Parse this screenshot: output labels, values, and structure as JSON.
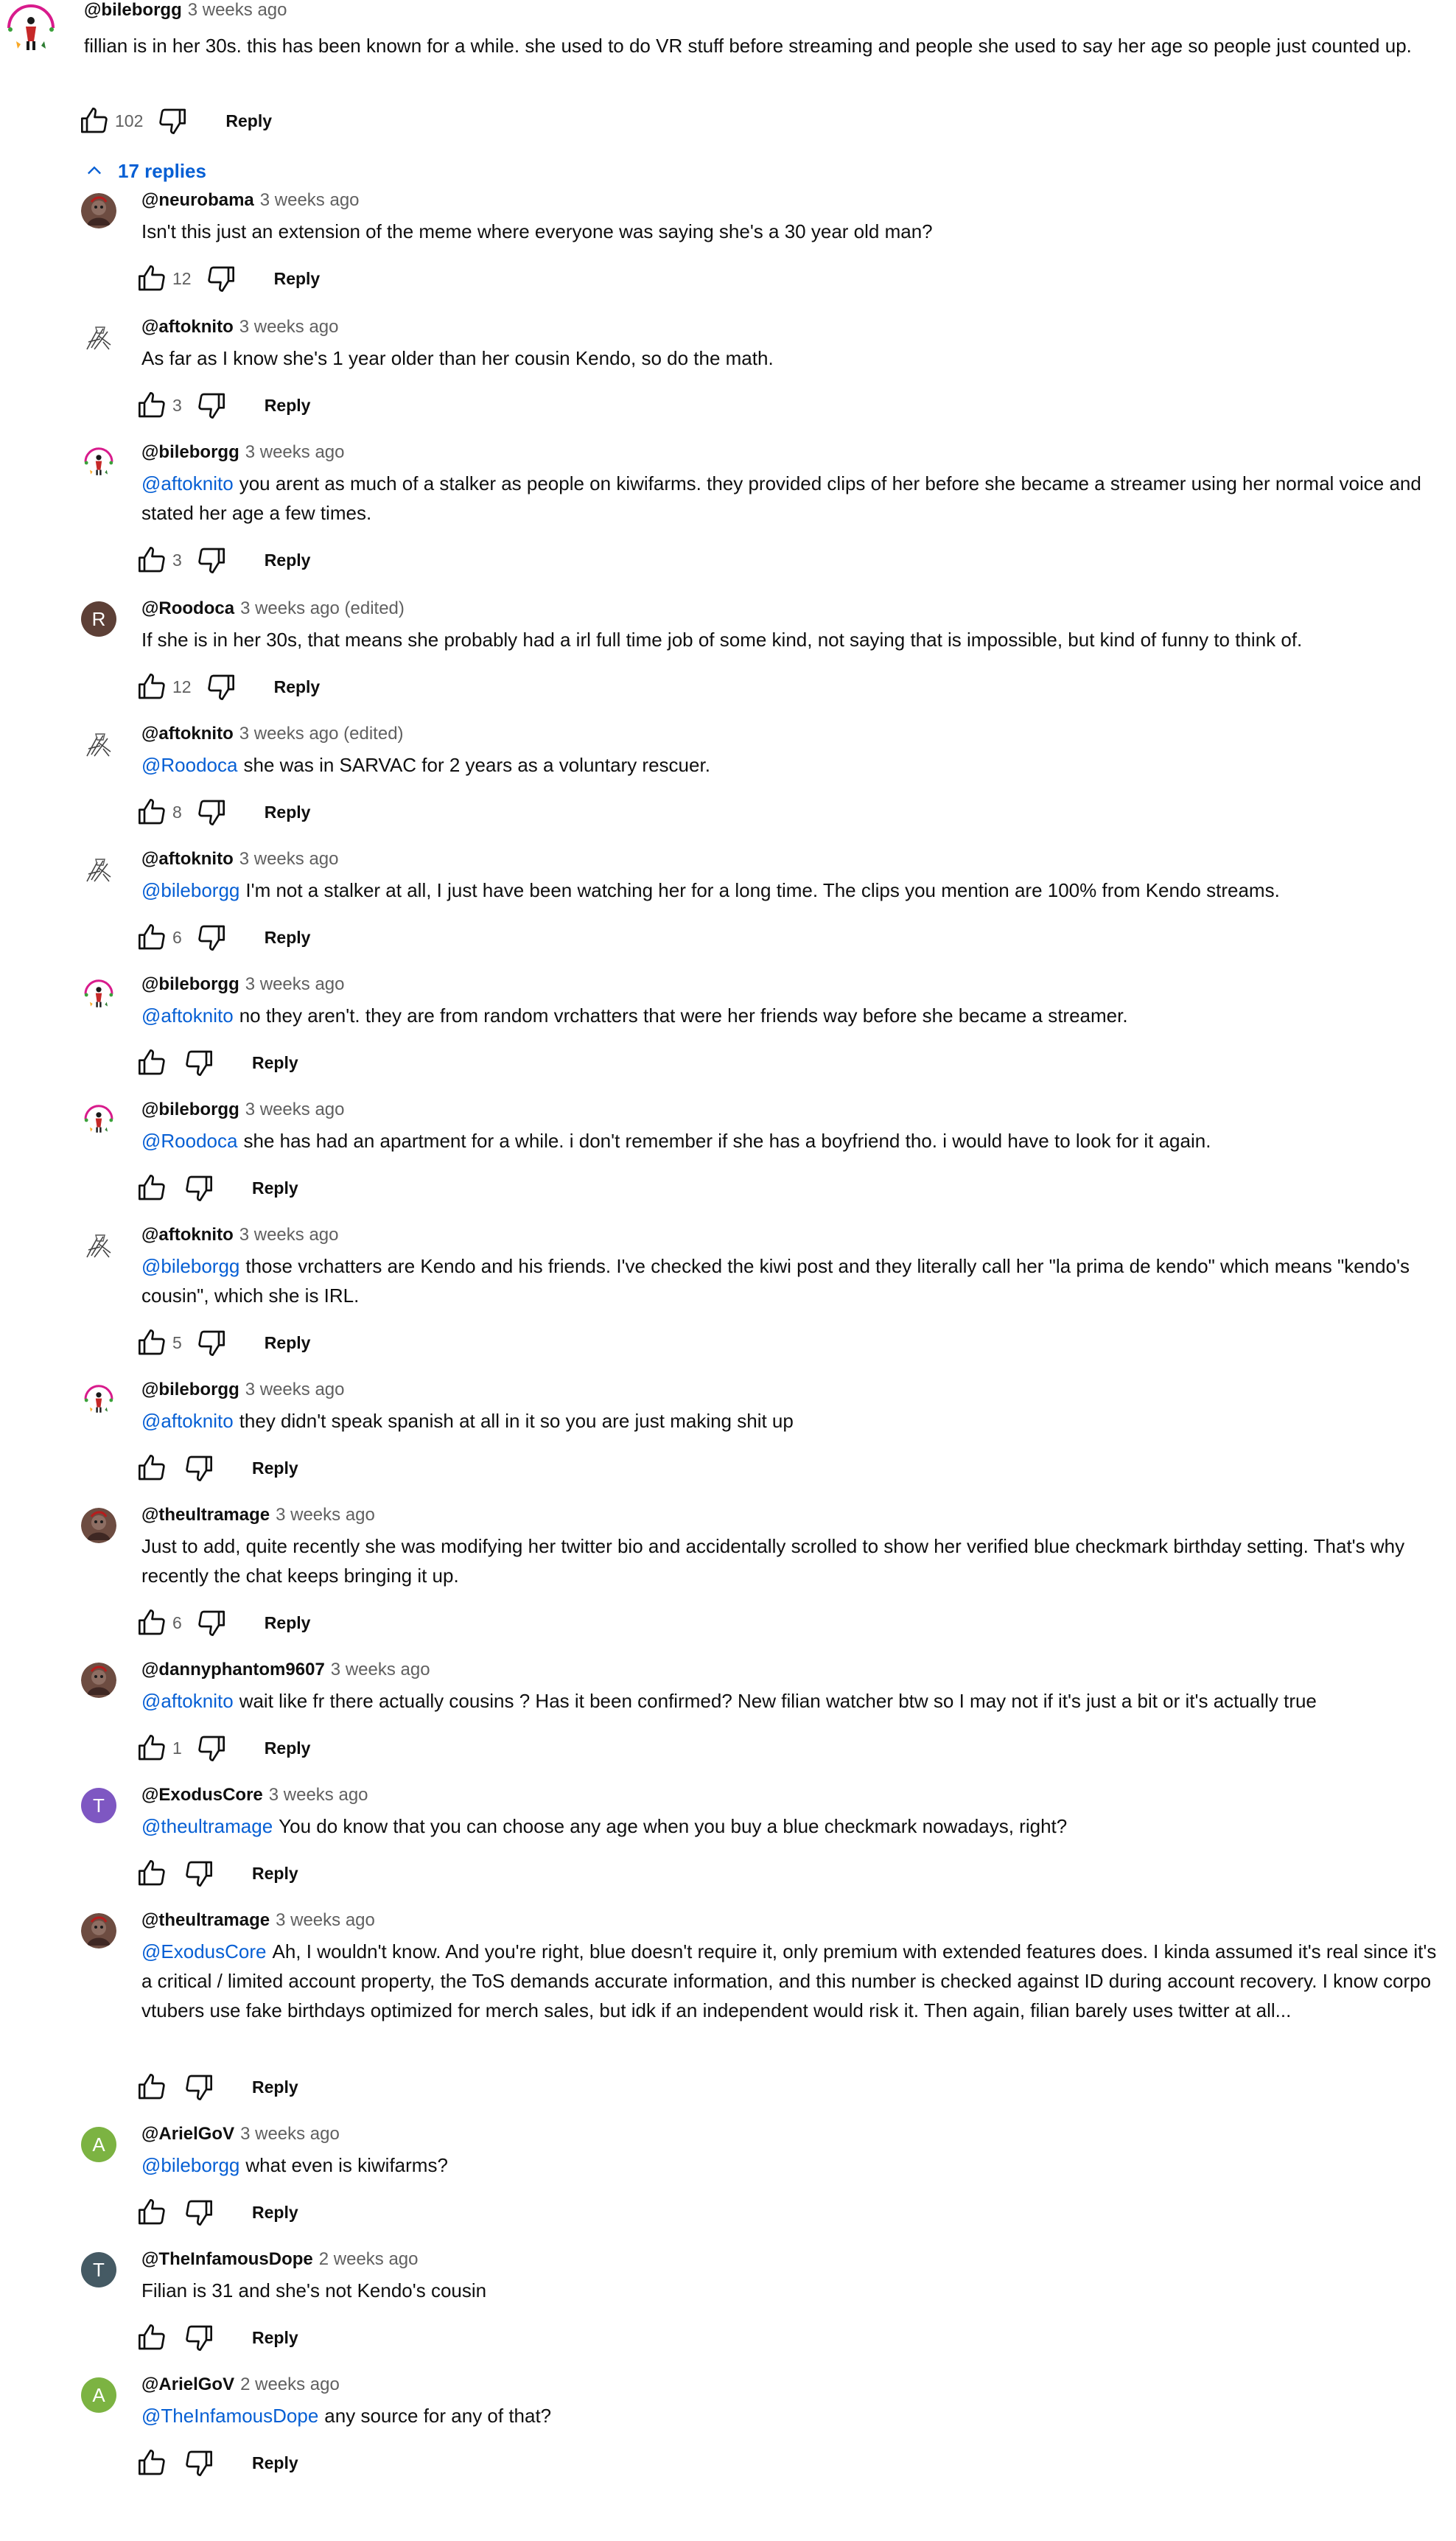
{
  "top_comment": {
    "author": "@bileborgg",
    "time": "3 weeks ago",
    "text": "fillian is in her 30s. this has been known for a while. she used to do VR stuff before streaming and people she used to say her age so people just counted up.",
    "likes": "102",
    "reply_label": "Reply"
  },
  "replies_toggle": {
    "label": "17 replies"
  },
  "colors": {
    "link": "#065fd4",
    "secondary_text": "#606060",
    "avatar_brown": "#5d4037",
    "avatar_purple": "#7e57c2",
    "avatar_green": "#7cb342",
    "avatar_slate": "#455a64"
  },
  "replies": [
    {
      "author": "@neurobama",
      "time": "3 weeks ago",
      "mention": "",
      "text": "Isn't this just an extension of the meme where everyone was saying she's a 30 year old man?",
      "likes": "12",
      "reply_label": "Reply",
      "avatar_icon": "photo-avatar-icon"
    },
    {
      "author": "@aftoknito",
      "time": "3 weeks ago",
      "mention": "",
      "text": "As far as I know she's 1 year older than her cousin Kendo, so do the math.",
      "likes": "3",
      "reply_label": "Reply",
      "avatar_icon": "sketch-avatar-icon"
    },
    {
      "author": "@bileborgg",
      "time": "3 weeks ago",
      "mention": "@aftoknito",
      "text": "you arent as much of a stalker as people on kiwifarms. they provided clips of her before she became a streamer using her normal voice and stated her age a few times.",
      "likes": "3",
      "reply_label": "Reply",
      "avatar_icon": "figure-avatar-icon"
    },
    {
      "author": "@Roodoca",
      "time": "3 weeks ago (edited)",
      "mention": "",
      "text": "If she is in her 30s, that means she probably had a irl full time job of some kind, not saying that is impossible, but kind of funny to think of.",
      "likes": "12",
      "reply_label": "Reply",
      "avatar_letter": "R"
    },
    {
      "author": "@aftoknito",
      "time": "3 weeks ago (edited)",
      "mention": "@Roodoca",
      "text": "she was in SARVAC for 2 years as a voluntary rescuer.",
      "likes": "8",
      "reply_label": "Reply",
      "avatar_icon": "sketch-avatar-icon"
    },
    {
      "author": "@aftoknito",
      "time": "3 weeks ago",
      "mention": "@bileborgg",
      "text": "I'm not a stalker at all, I just have been watching her for a long time. The clips you mention are 100% from Kendo streams.",
      "likes": "6",
      "reply_label": "Reply",
      "avatar_icon": "sketch-avatar-icon"
    },
    {
      "author": "@bileborgg",
      "time": "3 weeks ago",
      "mention": "@aftoknito",
      "text": "no they aren't. they are from random vrchatters that were her friends way before she became a streamer.",
      "likes": "",
      "reply_label": "Reply",
      "avatar_icon": "figure-avatar-icon"
    },
    {
      "author": "@bileborgg",
      "time": "3 weeks ago",
      "mention": "@Roodoca",
      "text": "she has had an apartment for a while. i don't remember if she has a boyfriend tho. i would have to look for it again.",
      "likes": "",
      "reply_label": "Reply",
      "avatar_icon": "figure-avatar-icon"
    },
    {
      "author": "@aftoknito",
      "time": "3 weeks ago",
      "mention": "@bileborgg",
      "text": "those vrchatters are Kendo and his friends. I've checked the kiwi post and they literally call her \"la prima de kendo\" which means \"kendo's cousin\", which she is IRL.",
      "likes": "5",
      "reply_label": "Reply",
      "avatar_icon": "sketch-avatar-icon"
    },
    {
      "author": "@bileborgg",
      "time": "3 weeks ago",
      "mention": "@aftoknito",
      "text": "they didn't speak spanish at all in it so you are just making shit up",
      "likes": "",
      "reply_label": "Reply",
      "avatar_icon": "figure-avatar-icon"
    },
    {
      "author": "@theultramage",
      "time": "3 weeks ago",
      "mention": "",
      "text": "Just to add, quite recently she was modifying her twitter bio and accidentally scrolled to show her verified blue checkmark birthday setting. That's why recently the chat keeps bringing it up.",
      "likes": "6",
      "reply_label": "Reply",
      "avatar_icon": "photo-avatar-icon"
    },
    {
      "author": "@dannyphantom9607",
      "time": "3 weeks ago",
      "mention": "@aftoknito",
      "text": "wait like fr there actually cousins ? Has it been confirmed? New filian watcher btw so I may not if it's just a bit or it's actually true",
      "likes": "1",
      "reply_label": "Reply",
      "avatar_icon": "photo-avatar-icon"
    },
    {
      "author": "@ExodusCore",
      "time": "3 weeks ago",
      "mention": "@theultramage",
      "text": "You do know that you can choose any age when you buy a blue checkmark nowadays, right?",
      "likes": "",
      "reply_label": "Reply",
      "avatar_letter": "T"
    },
    {
      "author": "@theultramage",
      "time": "3 weeks ago",
      "mention": "@ExodusCore",
      "text": "Ah, I wouldn't know. And you're right, blue doesn't require it, only premium with extended features does. I kinda assumed it's real since it's a critical / limited account property, the ToS demands accurate information, and this number is checked against ID during account recovery. I know corpo vtubers use fake birthdays optimized for merch sales, but idk if an independent would risk it. Then again, filian barely uses twitter at all...",
      "likes": "",
      "reply_label": "Reply",
      "avatar_icon": "photo-avatar-icon"
    },
    {
      "author": "@ArielGoV",
      "time": "3 weeks ago",
      "mention": "@bileborgg",
      "text": "what even is kiwifarms?",
      "likes": "",
      "reply_label": "Reply",
      "avatar_letter": "A"
    },
    {
      "author": "@TheInfamousDope",
      "time": "2 weeks ago",
      "mention": "",
      "text": "Filian is 31 and she's not Kendo's cousin",
      "likes": "",
      "reply_label": "Reply",
      "avatar_letter": "T"
    },
    {
      "author": "@ArielGoV",
      "time": "2 weeks ago",
      "mention": "@TheInfamousDope",
      "text": "any source for any of that?",
      "likes": "",
      "reply_label": "Reply",
      "avatar_letter": "A"
    }
  ]
}
